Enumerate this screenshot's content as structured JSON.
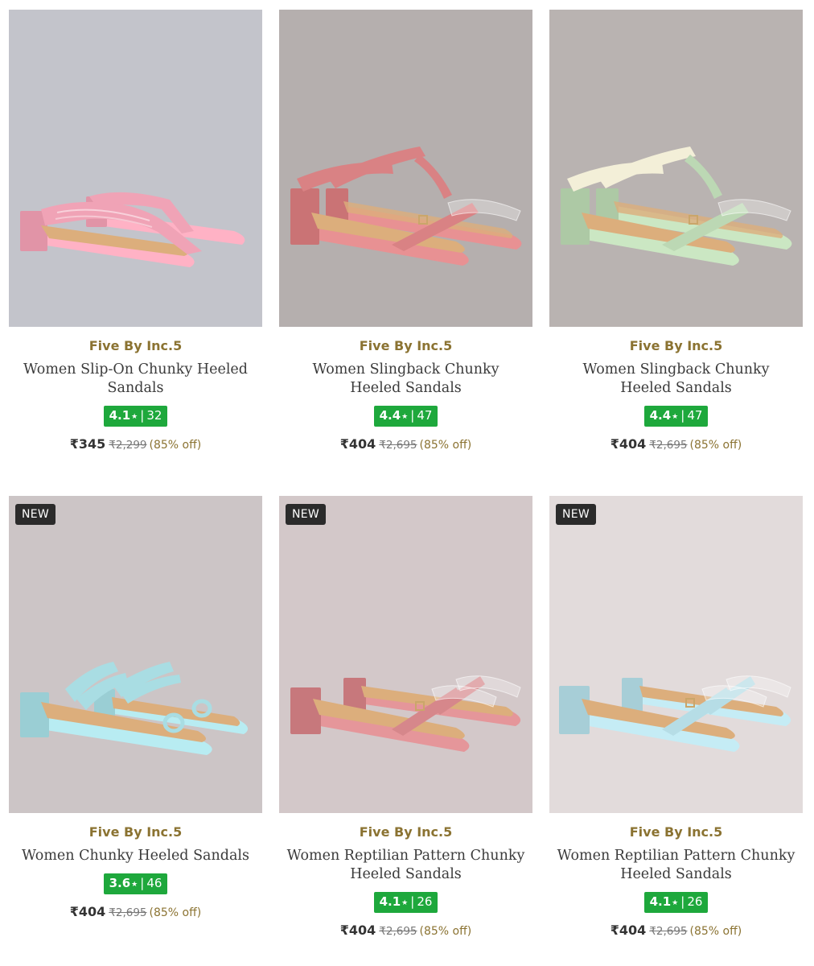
{
  "products": [
    {
      "brand": "Five By Inc.5",
      "name": "Women Slip-On Chunky Heeled Sandals",
      "rating": "4.1",
      "rating_count": "32",
      "price": "₹345",
      "mrp": "₹2,299",
      "discount": "(85% off)",
      "badge": "",
      "image_bg": "#c3c4cb",
      "shoe_color": "#f0a3b6"
    },
    {
      "brand": "Five By Inc.5",
      "name": "Women Slingback Chunky Heeled Sandals",
      "rating": "4.4",
      "rating_count": "47",
      "price": "₹404",
      "mrp": "₹2,695",
      "discount": "(85% off)",
      "badge": "",
      "image_bg": "#b5afae",
      "shoe_color": "#d98284"
    },
    {
      "brand": "Five By Inc.5",
      "name": "Women Slingback Chunky Heeled Sandals",
      "rating": "4.4",
      "rating_count": "47",
      "price": "₹404",
      "mrp": "₹2,695",
      "discount": "(85% off)",
      "badge": "",
      "image_bg": "#b9b3b1",
      "shoe_color": "#bcd8b4"
    },
    {
      "brand": "Five By Inc.5",
      "name": "Women Chunky Heeled Sandals",
      "rating": "3.6",
      "rating_count": "46",
      "price": "₹404",
      "mrp": "₹2,695",
      "discount": "(85% off)",
      "badge": "NEW",
      "image_bg": "#ccc5c6",
      "shoe_color": "#a9dde3"
    },
    {
      "brand": "Five By Inc.5",
      "name": "Women Reptilian Pattern Chunky Heeled Sandals",
      "rating": "4.1",
      "rating_count": "26",
      "price": "₹404",
      "mrp": "₹2,695",
      "discount": "(85% off)",
      "badge": "NEW",
      "image_bg": "#d3c8c9",
      "shoe_color": "#d6878b"
    },
    {
      "brand": "Five By Inc.5",
      "name": "Women Reptilian Pattern Chunky Heeled Sandals",
      "rating": "4.1",
      "rating_count": "26",
      "price": "₹404",
      "mrp": "₹2,695",
      "discount": "(85% off)",
      "badge": "NEW",
      "image_bg": "#e2dbdb",
      "shoe_color": "#b6dde6"
    }
  ],
  "rating_star_icon": "star-icon",
  "colors": {
    "brand_text": "#8b7332",
    "rating_bg": "#1ea83c",
    "badge_bg": "#2b2b2b"
  }
}
